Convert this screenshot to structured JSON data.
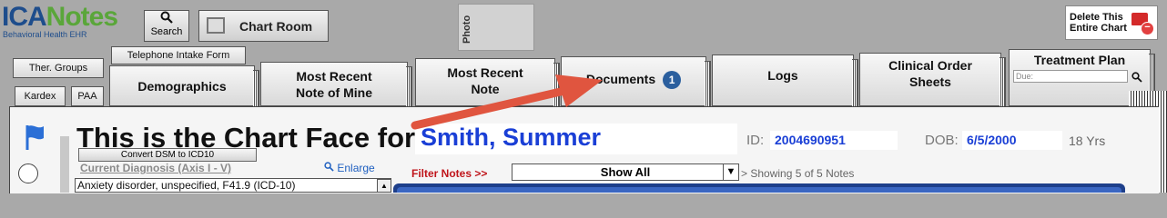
{
  "app": {
    "logo_main_a": "ICA",
    "logo_main_b": "Notes",
    "logo_tagline": "Behavioral Health EHR"
  },
  "toolbar": {
    "search_label": "Search",
    "search_icon": "magnifier-icon",
    "chart_room_label": "Chart Room",
    "photo_label": "Photo",
    "delete_label_line1": "Delete This",
    "delete_label_line2": "Entire Chart"
  },
  "tabs": {
    "ther_groups": "Ther. Groups",
    "telephone_intake": "Telephone Intake Form",
    "kardex": "Kardex",
    "paa": "PAA",
    "demographics": "Demographics",
    "most_recent_note_of_mine_1": "Most Recent",
    "most_recent_note_of_mine_2": "Note of Mine",
    "most_recent_note_1": "Most Recent",
    "most_recent_note_2": "Note",
    "documents": "Documents",
    "documents_badge": "1",
    "logs": "Logs",
    "clinical_order_1": "Clinical Order",
    "clinical_order_2": "Sheets",
    "treatment_plan": "Treatment Plan",
    "treatment_due_placeholder": "Due:"
  },
  "chart": {
    "headline": "This is the Chart Face for:",
    "patient_name": "Smith, Summer",
    "id_label": "ID:",
    "id_value": "2004690951",
    "dob_label": "DOB:",
    "dob_value": "6/5/2000",
    "age": "18 Yrs",
    "convert_button": "Convert DSM to ICD10",
    "current_diagnosis_label": "Current Diagnosis (Axis I - V)",
    "enlarge_label": "Enlarge",
    "diagnosis_text": "Anxiety disorder, unspecified, F41.9 (ICD-10)",
    "filter_label": "Filter Notes >>",
    "filter_value": "Show All",
    "showing_text": "> Showing 5 of 5 Notes"
  },
  "colors": {
    "accent_blue": "#1a3fd6",
    "badge_blue": "#2b5f9e",
    "arrow_red": "#e0553f",
    "filter_red": "#c0151b"
  }
}
